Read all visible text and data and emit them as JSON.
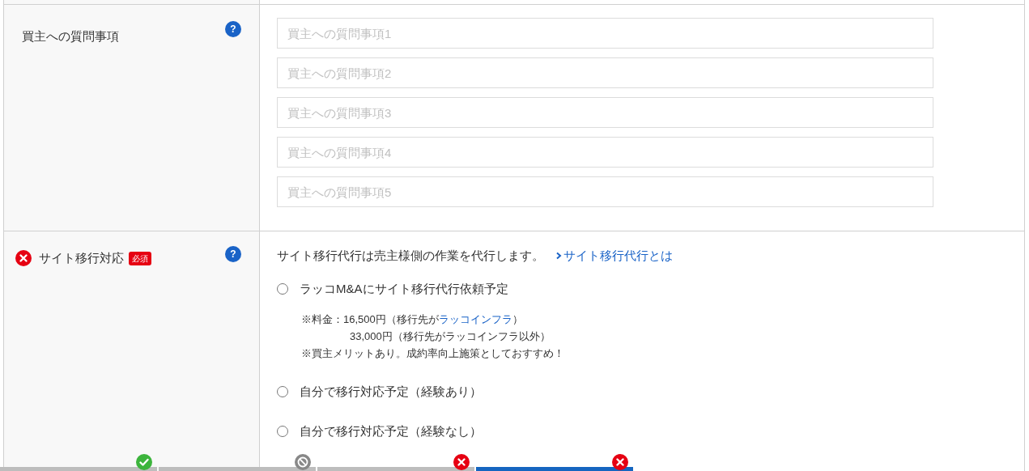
{
  "question_row": {
    "label": "買主への質問事項",
    "help": "?",
    "fields": [
      {
        "placeholder": "買主への質問事項1"
      },
      {
        "placeholder": "買主への質問事項2"
      },
      {
        "placeholder": "買主への質問事項3"
      },
      {
        "placeholder": "買主への質問事項4"
      },
      {
        "placeholder": "買主への質問事項5"
      }
    ]
  },
  "migration_row": {
    "label": "サイト移行対応",
    "error": true,
    "required_badge": "必須",
    "help": "?",
    "intro": "サイト移行代行は売主様側の作業を代行します。",
    "link": "サイト移行代行とは",
    "options": [
      {
        "label": "ラッコM&Aにサイト移行代行依頼予定",
        "selected": false,
        "notes": [
          {
            "kind": "linked",
            "before": "※料金：16,500円（移行先が",
            "link": "ラッコインフラ",
            "after": "）"
          },
          {
            "kind": "indented",
            "text": "33,000円（移行先がラッコインフラ以外）"
          },
          {
            "kind": "plain",
            "text": "※買主メリットあり。成約率向上施策としておすすめ！"
          }
        ]
      },
      {
        "label": "自分で移行対応予定（経験あり）",
        "selected": false
      },
      {
        "label": "自分で移行対応予定（経験なし）",
        "selected": false
      }
    ]
  },
  "progress_steps": [
    {
      "kind": "done",
      "selected": false
    },
    {
      "kind": "skipped",
      "selected": false
    },
    {
      "kind": "error",
      "selected": false
    },
    {
      "kind": "error",
      "selected": true
    }
  ]
}
